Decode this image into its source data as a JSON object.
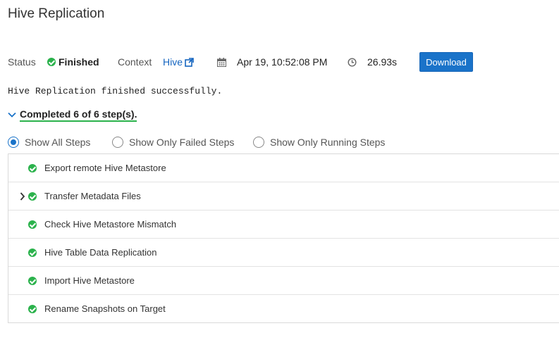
{
  "page": {
    "title": "Hive Replication"
  },
  "status_bar": {
    "status_label": "Status",
    "status_value": "Finished",
    "context_label": "Context",
    "context_link": "Hive",
    "date": "Apr 19, 10:52:08 PM",
    "duration": "26.93s",
    "download_label": "Download"
  },
  "message": "Hive Replication finished successfully.",
  "completed_label": "Completed 6 of 6 step(s).",
  "filters": [
    {
      "label": "Show All Steps",
      "selected": true
    },
    {
      "label": "Show Only Failed Steps",
      "selected": false
    },
    {
      "label": "Show Only Running Steps",
      "selected": false
    }
  ],
  "steps": [
    {
      "label": "Export remote Hive Metastore",
      "status": "success",
      "expandable": false
    },
    {
      "label": "Transfer Metadata Files",
      "status": "success",
      "expandable": true
    },
    {
      "label": "Check Hive Metastore Mismatch",
      "status": "success",
      "expandable": false
    },
    {
      "label": "Hive Table Data Replication",
      "status": "success",
      "expandable": false
    },
    {
      "label": "Import Hive Metastore",
      "status": "success",
      "expandable": false
    },
    {
      "label": "Rename Snapshots on Target",
      "status": "success",
      "expandable": false
    }
  ],
  "colors": {
    "success": "#2bb24c",
    "primary": "#1a73c9",
    "link": "#1565c0"
  }
}
